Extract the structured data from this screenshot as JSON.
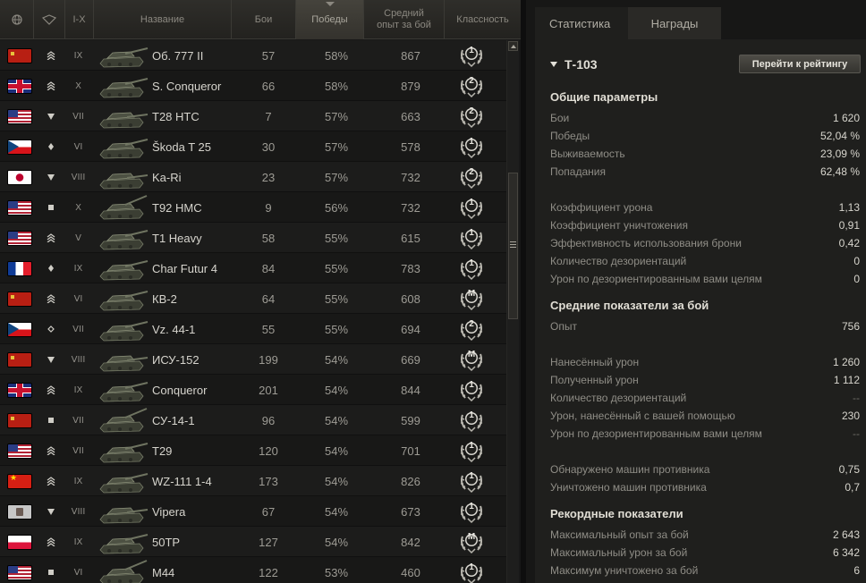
{
  "table": {
    "headers": {
      "tier": "I-X",
      "name": "Название",
      "battles": "Бои",
      "wins": "Победы",
      "avg_xp": "Средний опыт за бой",
      "mastery": "Классность"
    },
    "rows": [
      {
        "flag": "ussr",
        "type": "ht",
        "tier": "IX",
        "name": "Об. 777 II",
        "battles": "57",
        "wins": "58%",
        "xp": "867",
        "mastery": "1"
      },
      {
        "flag": "uk",
        "type": "ht",
        "tier": "X",
        "name": "S. Conqueror",
        "battles": "66",
        "wins": "58%",
        "xp": "879",
        "mastery": "2"
      },
      {
        "flag": "usa",
        "type": "td",
        "tier": "VII",
        "name": "T28 HTC",
        "battles": "7",
        "wins": "57%",
        "xp": "663",
        "mastery": "2"
      },
      {
        "flag": "cz",
        "type": "mt",
        "tier": "VI",
        "name": "Škoda T 25",
        "battles": "30",
        "wins": "57%",
        "xp": "578",
        "mastery": "1"
      },
      {
        "flag": "jp",
        "type": "td",
        "tier": "VIII",
        "name": "Ka-Ri",
        "battles": "23",
        "wins": "57%",
        "xp": "732",
        "mastery": "2"
      },
      {
        "flag": "usa",
        "type": "spg",
        "tier": "X",
        "name": "T92 HMC",
        "battles": "9",
        "wins": "56%",
        "xp": "732",
        "mastery": "1"
      },
      {
        "flag": "usa",
        "type": "ht",
        "tier": "V",
        "name": "T1 Heavy",
        "battles": "58",
        "wins": "55%",
        "xp": "615",
        "mastery": "1"
      },
      {
        "flag": "fr",
        "type": "mt",
        "tier": "IX",
        "name": "Char Futur 4",
        "battles": "84",
        "wins": "55%",
        "xp": "783",
        "mastery": "1"
      },
      {
        "flag": "ussr",
        "type": "ht",
        "tier": "VI",
        "name": "КВ-2",
        "battles": "64",
        "wins": "55%",
        "xp": "608",
        "mastery": "M"
      },
      {
        "flag": "cz",
        "type": "lt",
        "tier": "VII",
        "name": "Vz. 44-1",
        "battles": "55",
        "wins": "55%",
        "xp": "694",
        "mastery": "2"
      },
      {
        "flag": "ussr",
        "type": "td",
        "tier": "VIII",
        "name": "ИСУ-152",
        "battles": "199",
        "wins": "54%",
        "xp": "669",
        "mastery": "M"
      },
      {
        "flag": "uk",
        "type": "ht",
        "tier": "IX",
        "name": "Conqueror",
        "battles": "201",
        "wins": "54%",
        "xp": "844",
        "mastery": "1"
      },
      {
        "flag": "ussr",
        "type": "spg",
        "tier": "VII",
        "name": "СУ-14-1",
        "battles": "96",
        "wins": "54%",
        "xp": "599",
        "mastery": "1"
      },
      {
        "flag": "usa",
        "type": "ht",
        "tier": "VII",
        "name": "T29",
        "battles": "120",
        "wins": "54%",
        "xp": "701",
        "mastery": "1"
      },
      {
        "flag": "cn",
        "type": "ht",
        "tier": "IX",
        "name": "WZ-111 1-4",
        "battles": "173",
        "wins": "54%",
        "xp": "826",
        "mastery": "1"
      },
      {
        "flag": "it",
        "type": "td",
        "tier": "VIII",
        "name": "Vipera",
        "battles": "67",
        "wins": "54%",
        "xp": "673",
        "mastery": "1"
      },
      {
        "flag": "pl",
        "type": "ht",
        "tier": "IX",
        "name": "50TP",
        "battles": "127",
        "wins": "54%",
        "xp": "842",
        "mastery": "M"
      },
      {
        "flag": "usa",
        "type": "spg",
        "tier": "VI",
        "name": "M44",
        "battles": "122",
        "wins": "53%",
        "xp": "460",
        "mastery": "1"
      }
    ]
  },
  "tabs": [
    {
      "label": "Статистика",
      "active": true
    },
    {
      "label": "Награды",
      "active": false
    }
  ],
  "detail": {
    "vehicle": "Т-103",
    "rating_button": "Перейти к рейтингу",
    "sections": {
      "general": {
        "title": "Общие параметры",
        "rows": [
          {
            "label": "Бои",
            "value": "1 620"
          },
          {
            "label": "Победы",
            "value": "52,04 %"
          },
          {
            "label": "Выживаемость",
            "value": "23,09 %"
          },
          {
            "label": "Попадания",
            "value": "62,48 %"
          }
        ],
        "rows2": [
          {
            "label": "Коэффициент урона",
            "value": "1,13"
          },
          {
            "label": "Коэффициент уничтожения",
            "value": "0,91"
          },
          {
            "label": "Эффективность использования брони",
            "value": "0,42"
          },
          {
            "label": "Количество дезориентаций",
            "value": "0"
          },
          {
            "label": "Урон по дезориентированным вами целям",
            "value": "0"
          }
        ]
      },
      "average": {
        "title": "Средние показатели за бой",
        "rows": [
          {
            "label": "Опыт",
            "value": "756"
          }
        ],
        "rows2": [
          {
            "label": "Нанесённый урон",
            "value": "1 260"
          },
          {
            "label": "Полученный урон",
            "value": "1 112"
          },
          {
            "label": "Количество дезориентаций",
            "value": "--"
          },
          {
            "label": "Урон, нанесённый с вашей помощью",
            "value": "230"
          },
          {
            "label": "Урон по дезориентированным вами целям",
            "value": "--"
          }
        ],
        "rows3": [
          {
            "label": "Обнаружено машин противника",
            "value": "0,75"
          },
          {
            "label": "Уничтожено машин противника",
            "value": "0,7"
          }
        ]
      },
      "records": {
        "title": "Рекордные показатели",
        "rows": [
          {
            "label": "Максимальный опыт за бой",
            "value": "2 643"
          },
          {
            "label": "Максимальный урон за бой",
            "value": "6 342"
          },
          {
            "label": "Максимум уничтожено за бой",
            "value": "6"
          }
        ]
      }
    }
  }
}
